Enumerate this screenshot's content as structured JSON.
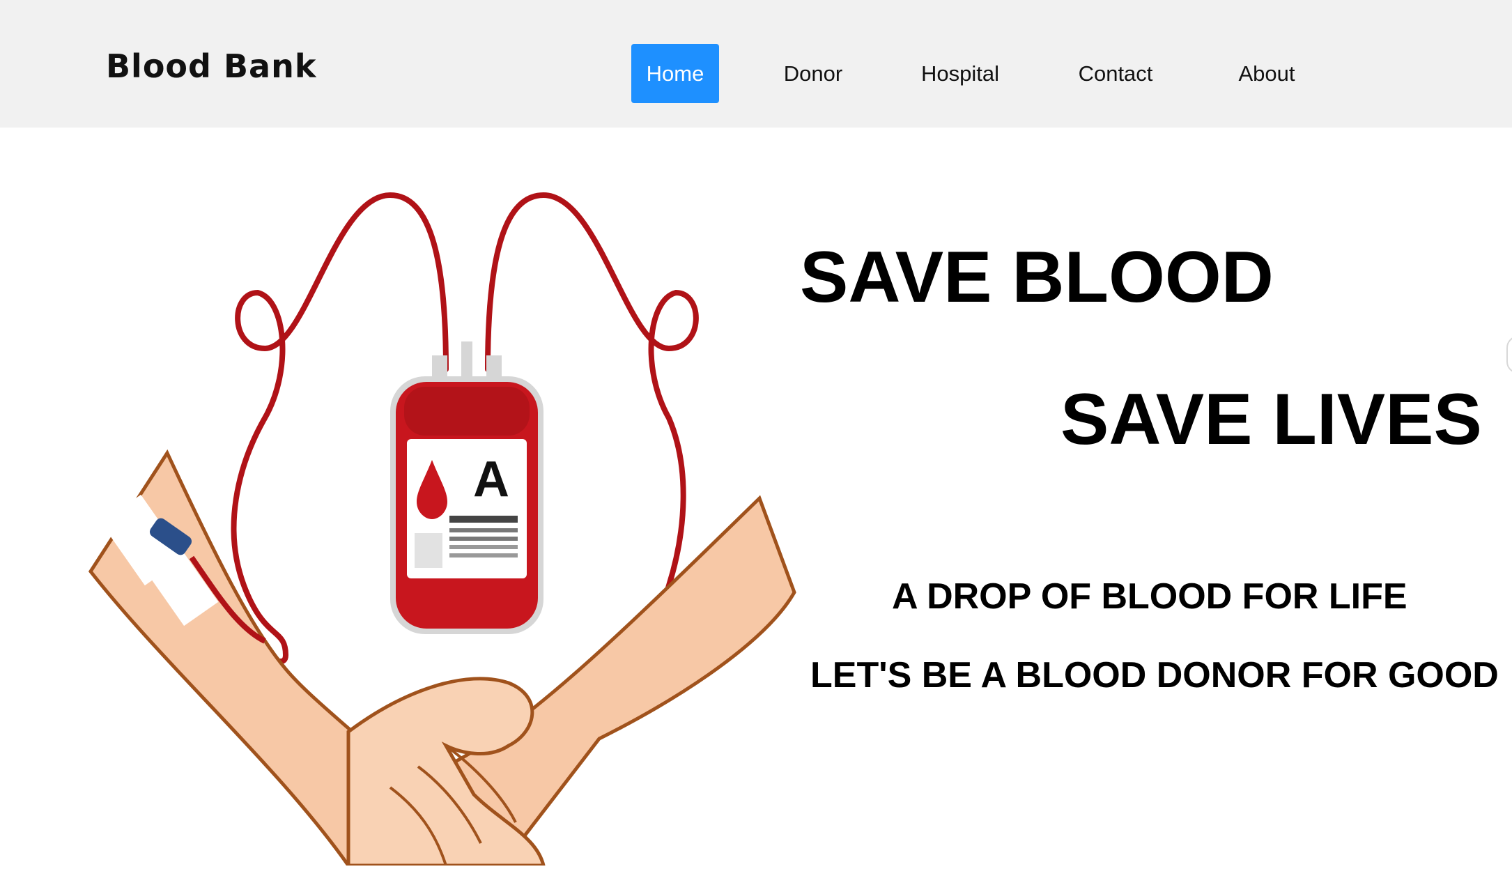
{
  "theme": {
    "accent": "#1e90ff",
    "blood_red": "#c8161e",
    "skin": "#f7c8a6"
  },
  "navbar": {
    "brand": "Blood Bank",
    "items": [
      {
        "label": "Home",
        "active": true
      },
      {
        "label": "Donor",
        "active": false
      },
      {
        "label": "Hospital",
        "active": false
      },
      {
        "label": "Contact",
        "active": false
      },
      {
        "label": "About",
        "active": false
      }
    ]
  },
  "hero": {
    "illustration": {
      "icon": "blood-donation-illustration",
      "bag_label": "A"
    },
    "headline_1": "SAVE BLOOD",
    "headline_2": "SAVE LIVES",
    "tagline_1": "A DROP OF BLOOD FOR LIFE",
    "tagline_2": "LET'S BE A BLOOD DONOR FOR GOOD"
  }
}
